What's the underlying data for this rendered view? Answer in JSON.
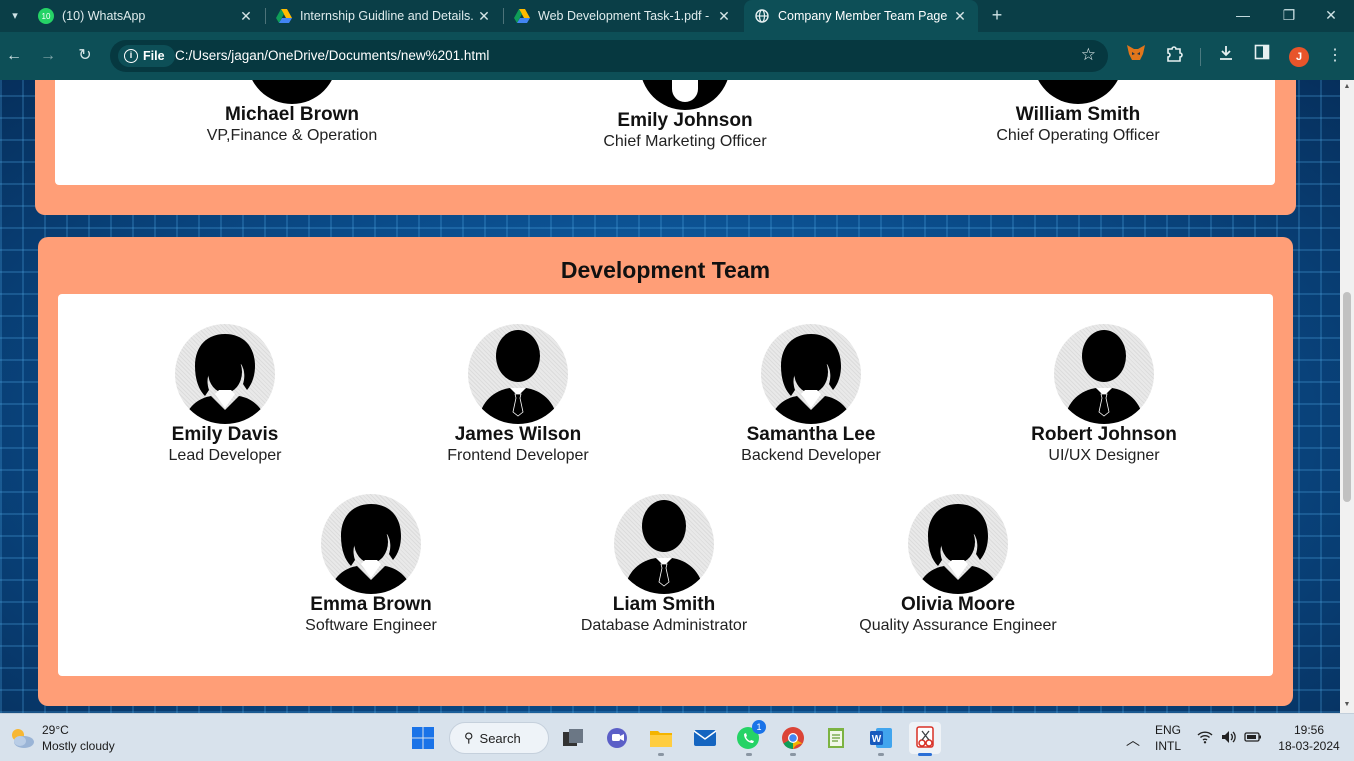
{
  "browser": {
    "tabs": [
      {
        "title": "(10) WhatsApp",
        "icon": "whatsapp-icon",
        "badge": "10",
        "active": false
      },
      {
        "title": "Internship Guidline and Details.",
        "icon": "google-drive-icon",
        "active": false
      },
      {
        "title": "Web Development Task-1.pdf -",
        "icon": "google-drive-icon",
        "active": false
      },
      {
        "title": "Company Member Team Page",
        "icon": "globe-icon",
        "active": true
      }
    ],
    "new_tab_glyph": "+",
    "address": {
      "scheme_chip": "File",
      "url": "C:/Users/jagan/OneDrive/Documents/new%201.html"
    },
    "profile_initial": "J"
  },
  "page": {
    "leadership_members": [
      {
        "name": "Michael Brown",
        "role": "VP,Finance & Operation"
      },
      {
        "name": "Emily Johnson",
        "role": "Chief Marketing Officer"
      },
      {
        "name": "William Smith",
        "role": "Chief Operating Officer"
      }
    ],
    "development_team": {
      "heading": "Development Team",
      "members": [
        {
          "name": "Emily Davis",
          "role": "Lead Developer",
          "avatar": "female-avatar-icon"
        },
        {
          "name": "James Wilson",
          "role": "Frontend Developer",
          "avatar": "male-avatar-icon"
        },
        {
          "name": "Samantha Lee",
          "role": "Backend Developer",
          "avatar": "female-avatar-icon"
        },
        {
          "name": "Robert Johnson",
          "role": "UI/UX Designer",
          "avatar": "male-avatar-icon"
        },
        {
          "name": "Emma Brown",
          "role": "Software Engineer",
          "avatar": "female-avatar-icon"
        },
        {
          "name": "Liam Smith",
          "role": "Database Administrator",
          "avatar": "male-avatar-icon"
        },
        {
          "name": "Olivia Moore",
          "role": "Quality Assurance Engineer",
          "avatar": "female-avatar-icon"
        }
      ]
    }
  },
  "taskbar": {
    "weather": {
      "temp": "29°C",
      "condition": "Mostly cloudy"
    },
    "search_label": "Search",
    "whatsapp_badge": "1",
    "language": {
      "line1": "ENG",
      "line2": "INTL"
    },
    "clock": {
      "time": "19:56",
      "date": "18-03-2024"
    }
  },
  "colors": {
    "card_background": "#ff9e77",
    "tab_strip": "#0a3e47",
    "toolbar": "#0d4f57"
  }
}
